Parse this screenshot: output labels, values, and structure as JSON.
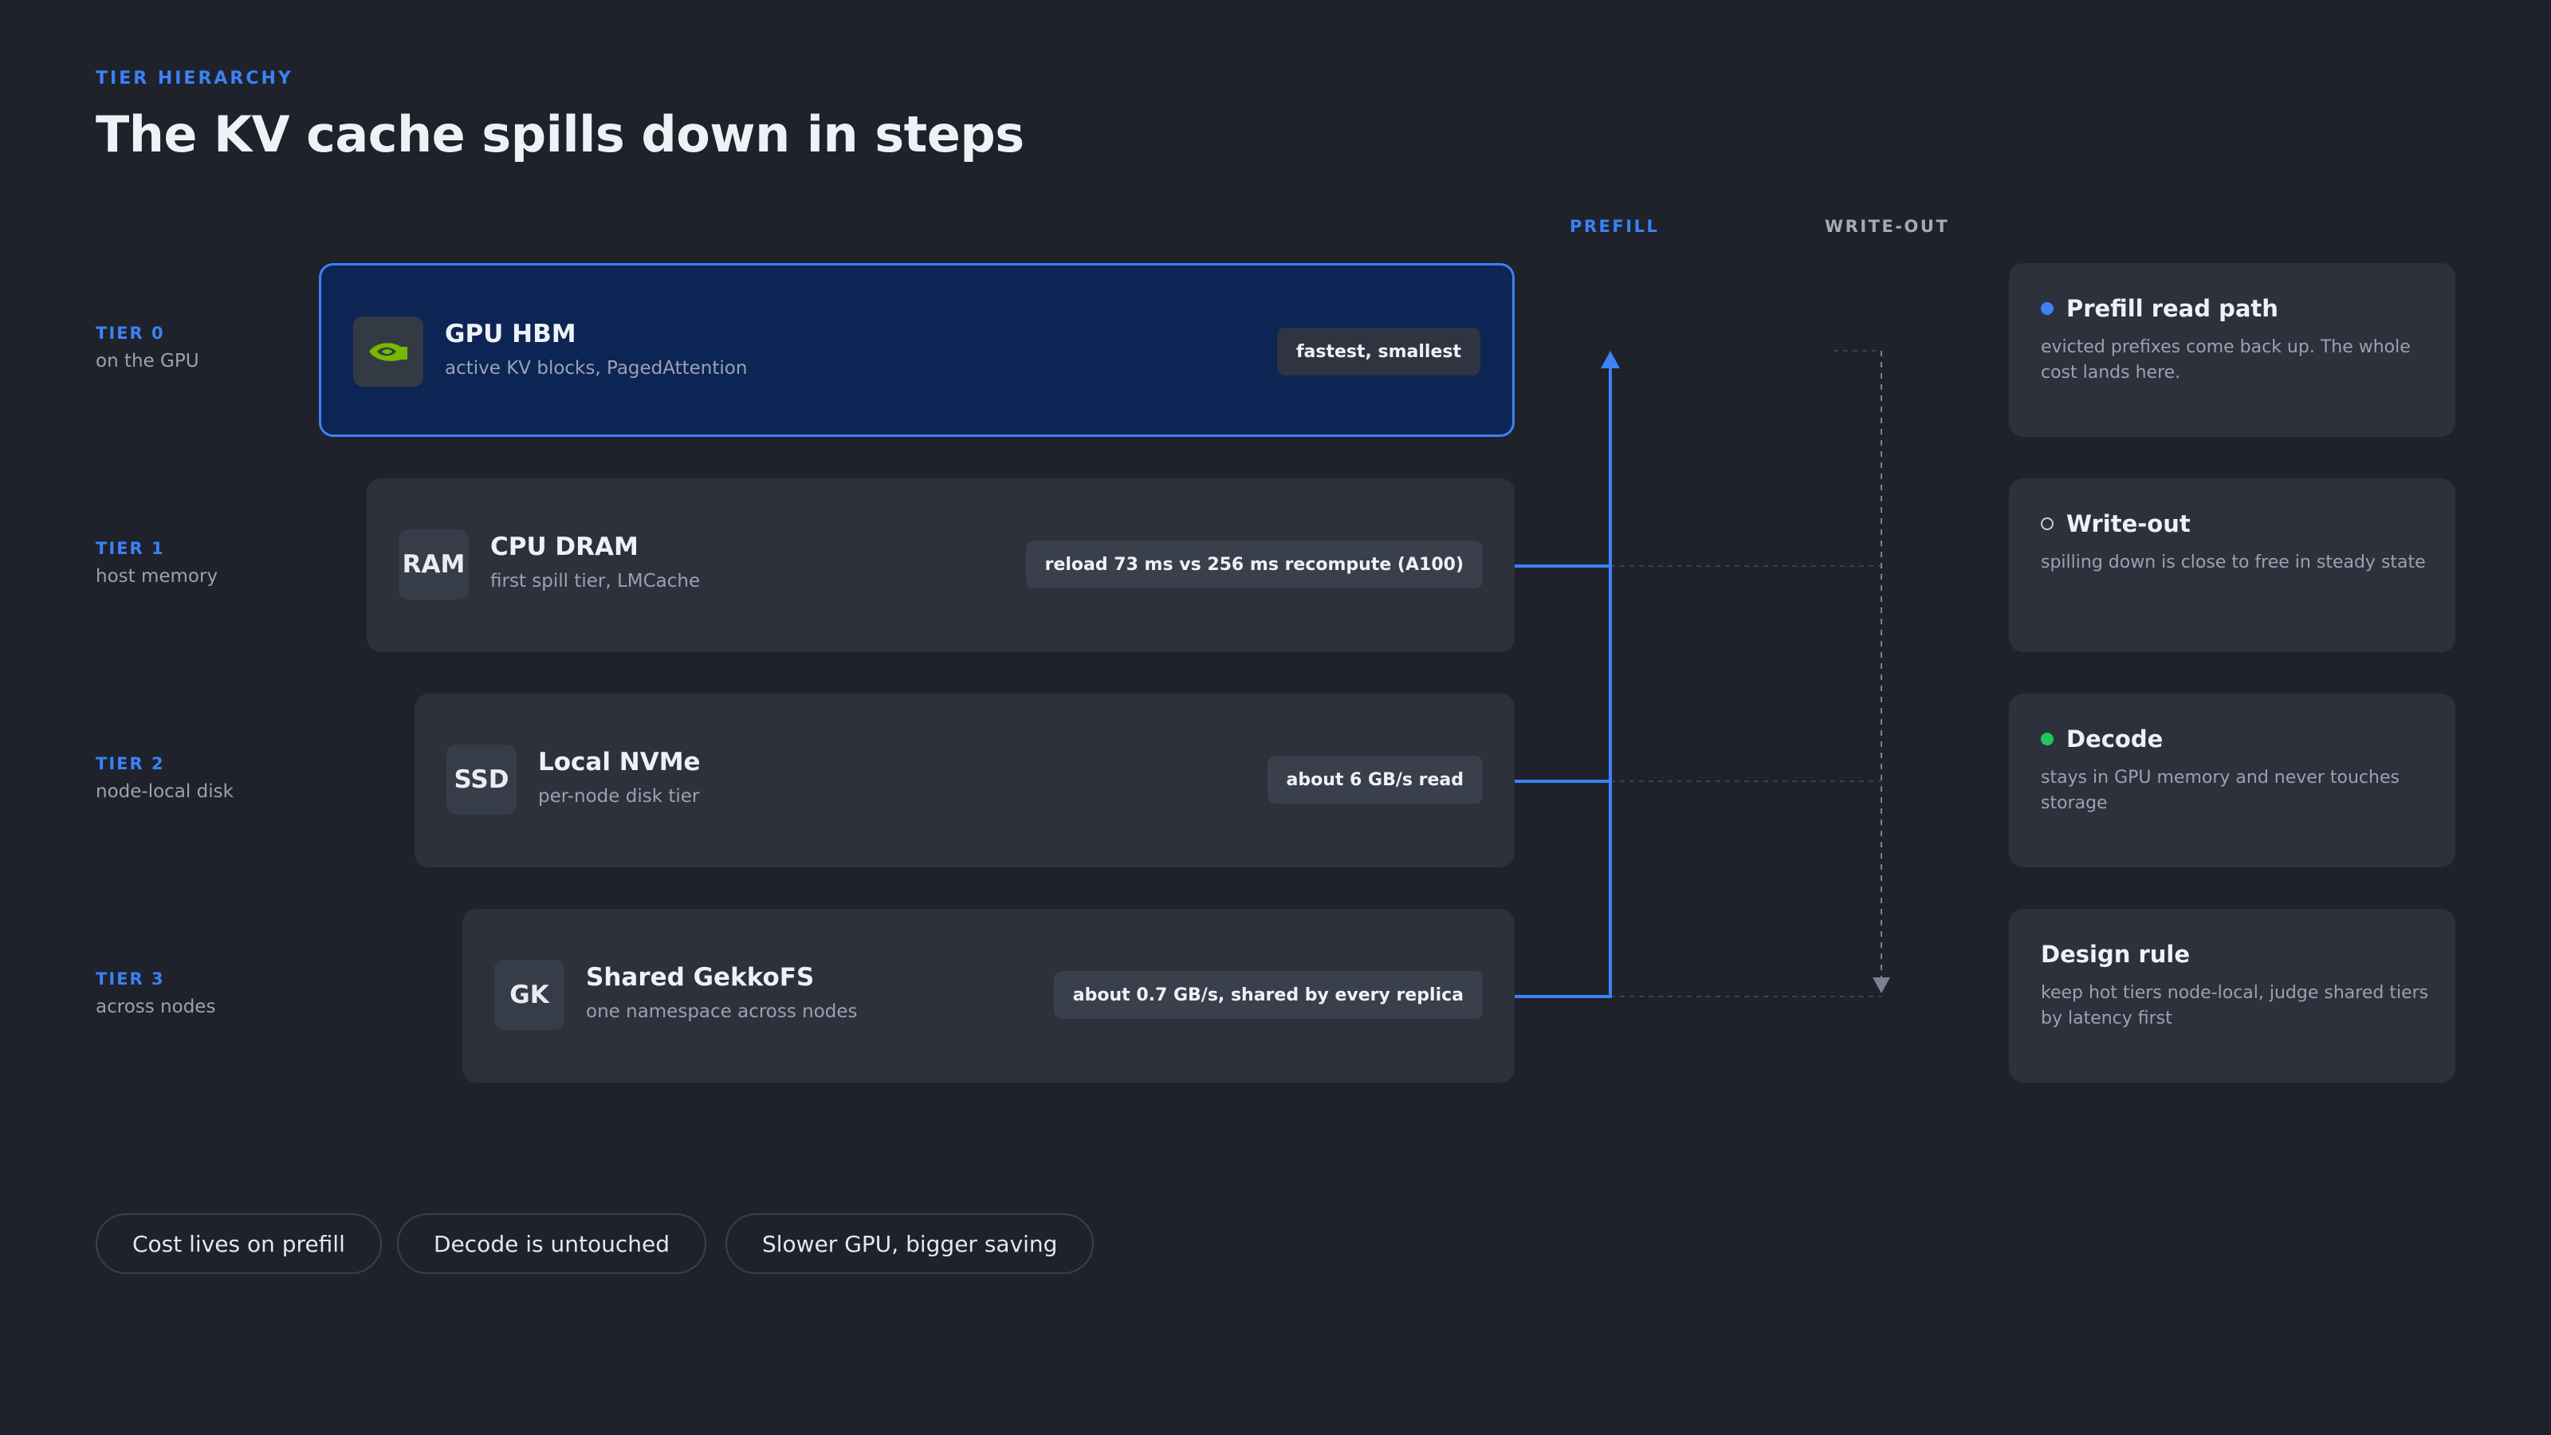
{
  "header": {
    "eyebrow": "TIER HIERARCHY",
    "title": "The KV cache spills down in steps"
  },
  "columns": {
    "prefill": "PREFILL",
    "writeout": "WRITE-OUT"
  },
  "tiers": [
    {
      "tier": "TIER 0",
      "tier_sub": "on the GPU",
      "icon": "nvidia-icon",
      "icon_text": "",
      "name": "GPU HBM",
      "sub": "active KV blocks, PagedAttention",
      "pill": "fastest, smallest"
    },
    {
      "tier": "TIER 1",
      "tier_sub": "host memory",
      "icon": "ram-icon",
      "icon_text": "RAM",
      "name": "CPU DRAM",
      "sub": "first spill tier, LMCache",
      "pill": "reload 73 ms vs 256 ms recompute (A100)"
    },
    {
      "tier": "TIER 2",
      "tier_sub": "node-local disk",
      "icon": "ssd-icon",
      "icon_text": "SSD",
      "name": "Local NVMe",
      "sub": "per-node disk tier",
      "pill": "about 6 GB/s read"
    },
    {
      "tier": "TIER 3",
      "tier_sub": "across nodes",
      "icon": "gk-icon",
      "icon_text": "GK",
      "name": "Shared GekkoFS",
      "sub": "one namespace across nodes",
      "pill": "about 0.7 GB/s, shared by every replica"
    }
  ],
  "side_notes": [
    {
      "title": "Prefill read path",
      "body": "evicted prefixes come back up. The whole cost lands here.",
      "marker": "filled-blue"
    },
    {
      "title": "Write-out",
      "body": "spilling down is close to free in steady state",
      "marker": "hollow-grey"
    },
    {
      "title": "Decode",
      "body": "stays in GPU memory and never touches storage",
      "marker": "filled-green"
    },
    {
      "title": "Design rule",
      "body": "keep hot tiers node-local, judge shared tiers by latency first",
      "marker": "none"
    }
  ],
  "chips": [
    "Cost lives on prefill",
    "Decode is untouched",
    "Slower GPU, bigger saving"
  ],
  "colors": {
    "accent": "#3b82f6",
    "background": "#1f222b",
    "card": "#2c313c",
    "active_card": "#0d2554",
    "decode_green": "#22c55e",
    "nvidia_green": "#76b900"
  }
}
